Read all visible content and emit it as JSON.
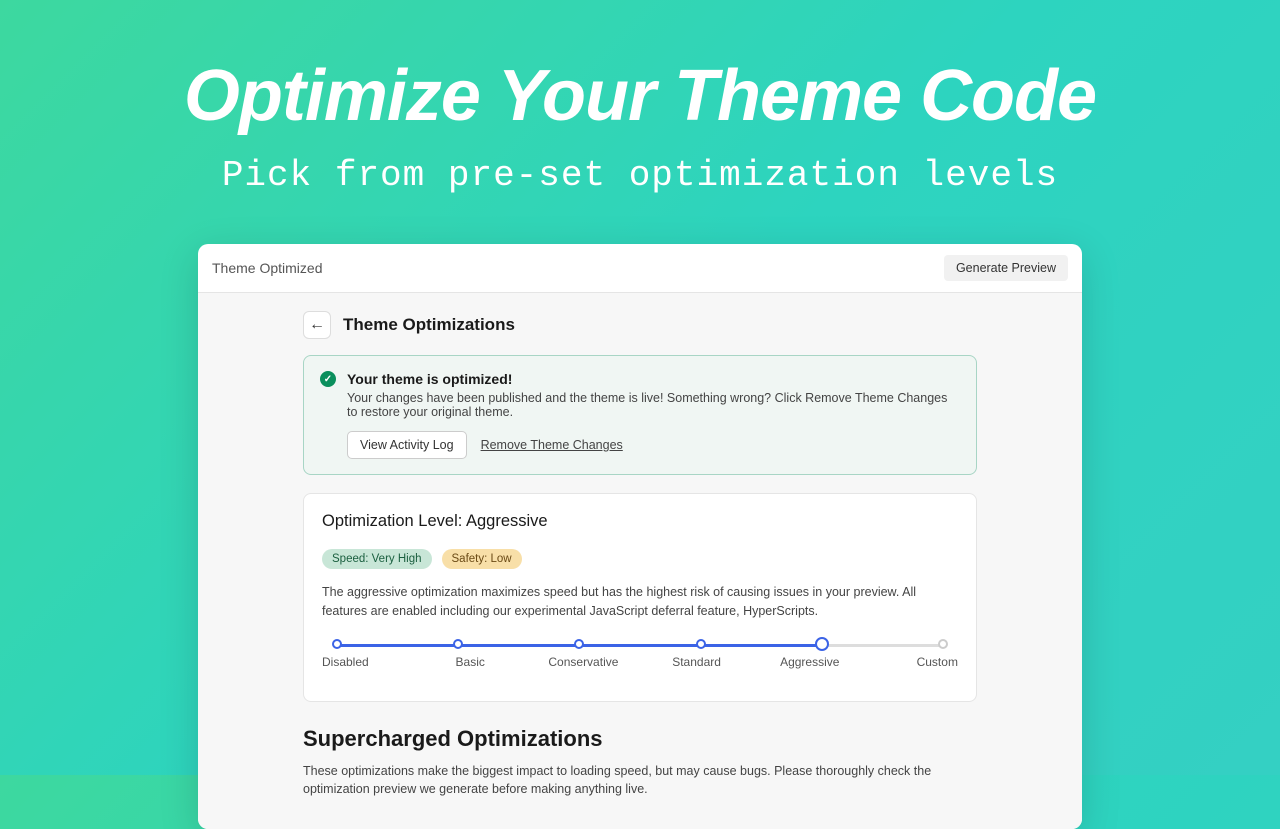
{
  "hero": {
    "title": "Optimize Your Theme Code",
    "subtitle": "Pick from pre-set optimization levels"
  },
  "app": {
    "title": "Theme Optimized",
    "generate_preview": "Generate Preview"
  },
  "page": {
    "back_icon": "←",
    "title": "Theme Optimizations"
  },
  "banner": {
    "check": "✓",
    "title": "Your theme is optimized!",
    "text": "Your changes have been published and the theme is live! Something wrong? Click Remove Theme Changes to restore your original theme.",
    "view_log": "View Activity Log",
    "remove": "Remove Theme Changes"
  },
  "level": {
    "title": "Optimization Level: Aggressive",
    "speed_badge": "Speed: Very High",
    "safety_badge": "Safety: Low",
    "description": "The aggressive optimization maximizes speed but has the highest risk of causing issues in your preview. All features are enabled including our experimental JavaScript deferral feature, HyperScripts.",
    "options": [
      "Disabled",
      "Basic",
      "Conservative",
      "Standard",
      "Aggressive",
      "Custom"
    ]
  },
  "supercharged": {
    "title": "Supercharged Optimizations",
    "description": "These optimizations make the biggest impact to loading speed, but may cause bugs. Please thoroughly check the optimization preview we generate before making anything live."
  }
}
